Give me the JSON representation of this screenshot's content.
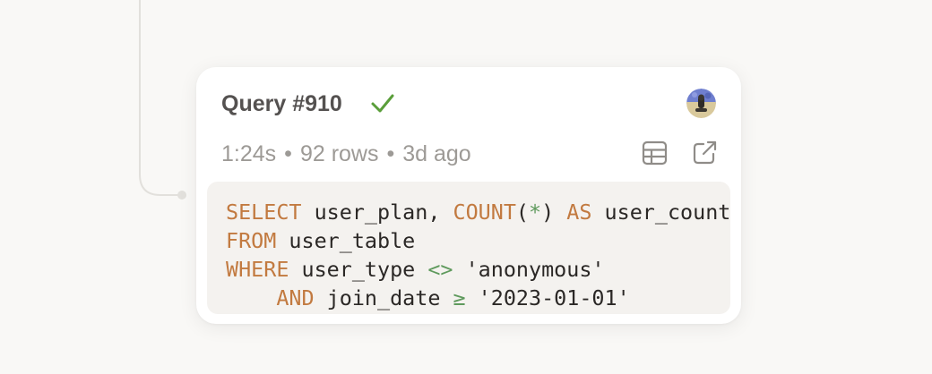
{
  "query": {
    "title": "Query #910",
    "status_icon": "check-icon",
    "status_color": "#5a9e3a",
    "duration": "1:24s",
    "rows": "92 rows",
    "age": "3d ago",
    "separator": "•"
  },
  "actions": {
    "table_icon": "table-icon",
    "open_icon": "external-link-icon"
  },
  "code": {
    "line1": {
      "kw1": "SELECT",
      "t1": " user_plan, ",
      "kw2": "COUNT",
      "p1": "(",
      "star": "*",
      "p2": ")",
      "t2": " ",
      "kw3": "AS",
      "t3": " user_count"
    },
    "line2": {
      "kw1": "FROM",
      "t1": " user_table"
    },
    "line3": {
      "kw1": "WHERE",
      "t1": " user_type ",
      "op": "<>",
      "t2": " 'anonymous'"
    },
    "line4": {
      "indent": "    ",
      "kw1": "AND",
      "t1": " join_date ",
      "op": "≥",
      "t2": " '2023-01-01'"
    }
  },
  "colors": {
    "background": "#f9f8f6",
    "keyword": "#c27a40",
    "operator": "#5f9a5d",
    "code_bg": "#f4f2ef"
  }
}
